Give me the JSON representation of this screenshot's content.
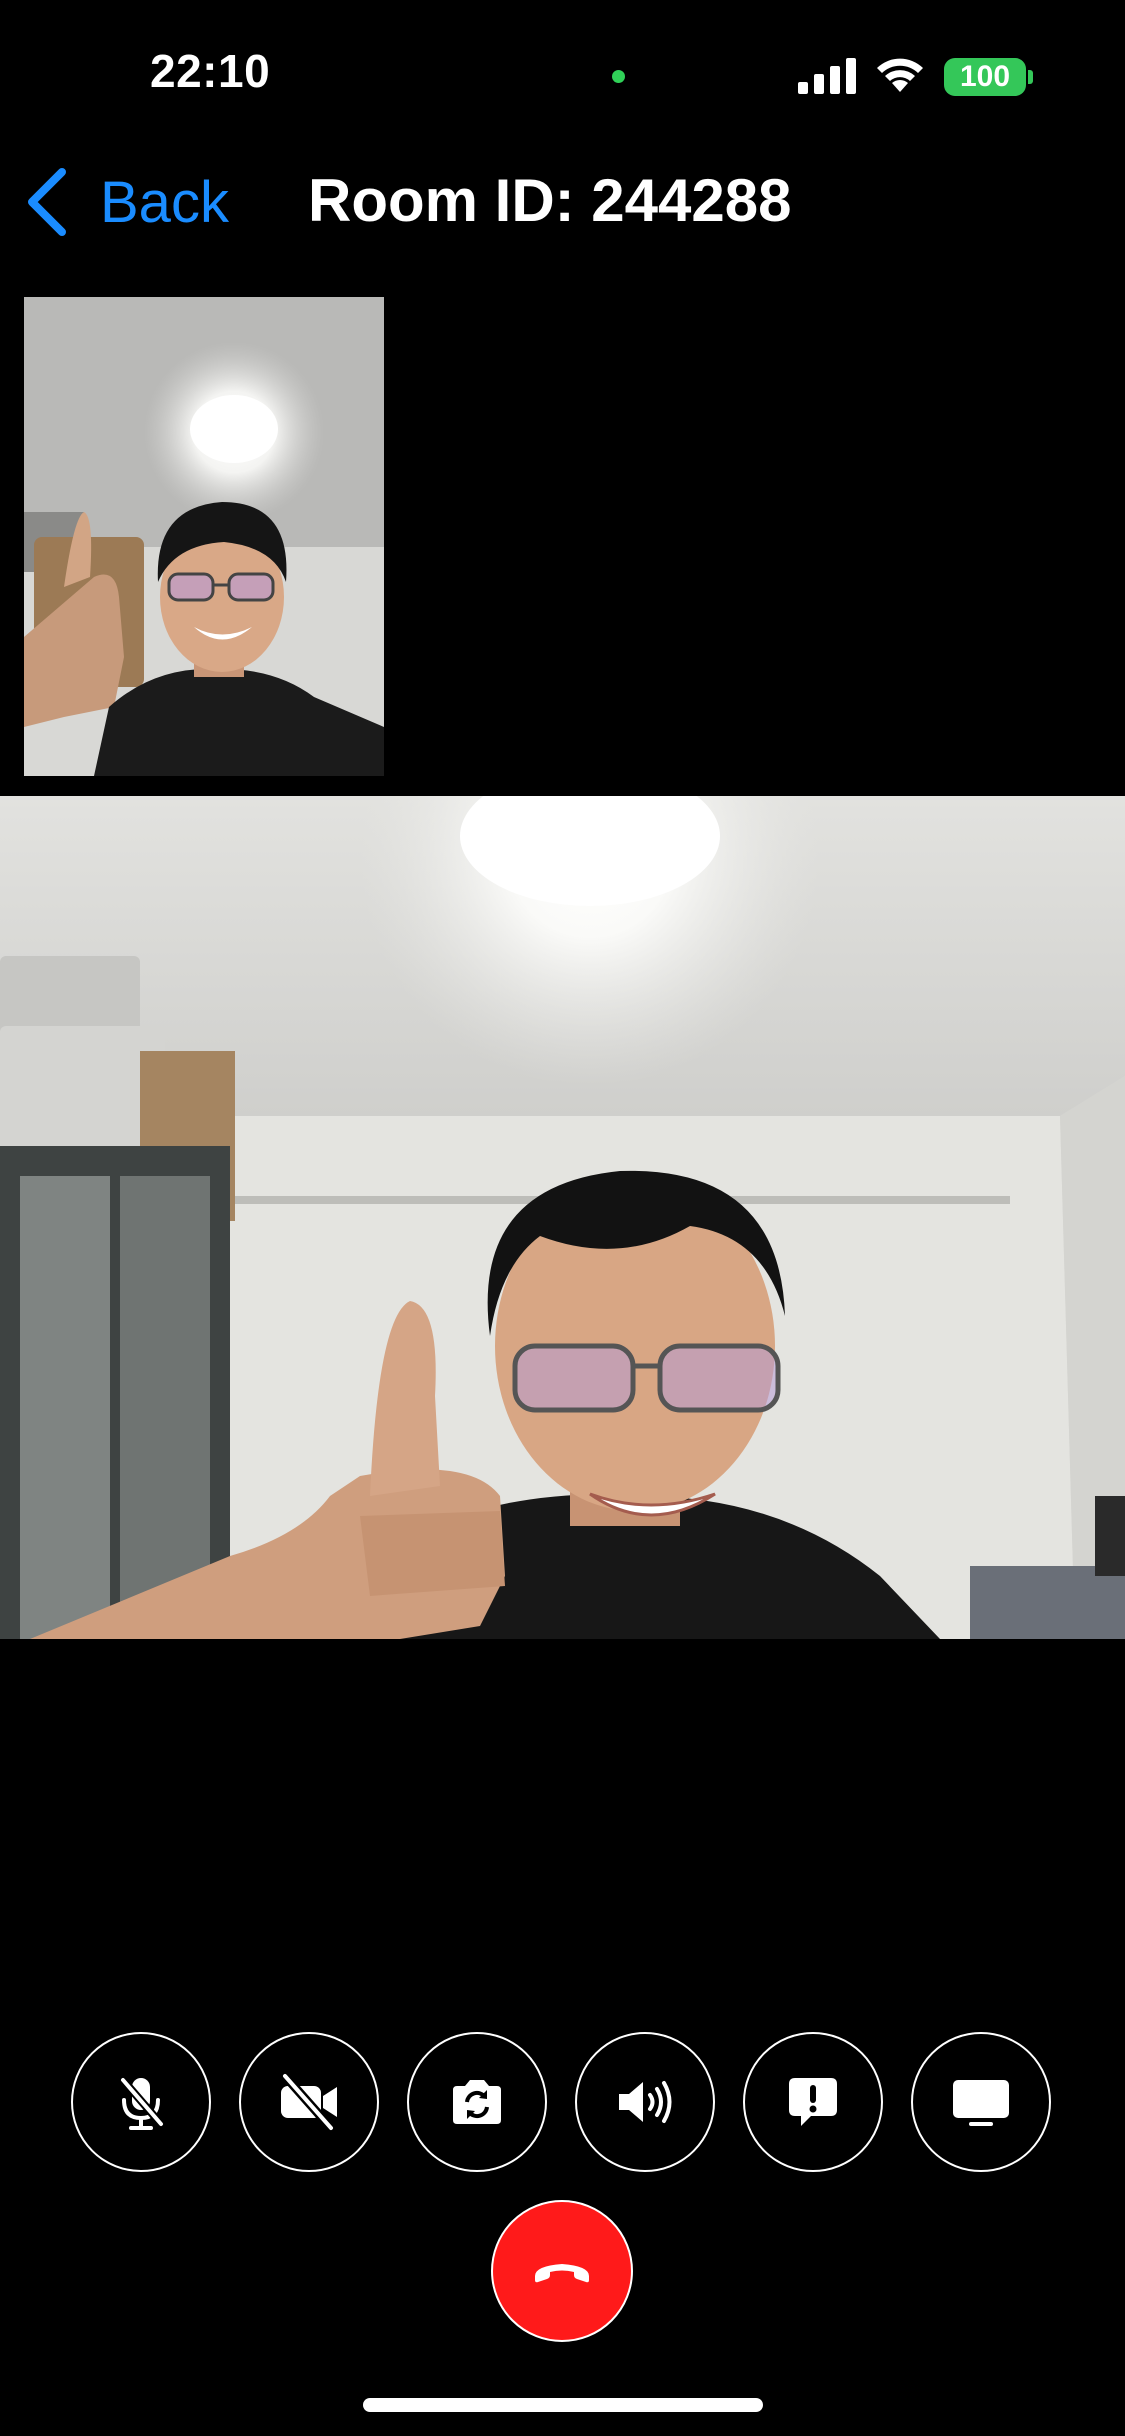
{
  "status_bar": {
    "time": "22:10",
    "battery": "100",
    "icons": [
      "privacy-dot",
      "signal-icon",
      "wifi-icon",
      "battery-icon"
    ]
  },
  "nav": {
    "back_label": "Back",
    "title": "Room ID: 244288",
    "back_icon": "chevron-left-icon"
  },
  "videos": {
    "local_preview": "camera-feed",
    "remote": "camera-feed"
  },
  "controls": [
    {
      "name": "mute-mic-button",
      "icon": "mic-off-icon"
    },
    {
      "name": "camera-off-button",
      "icon": "video-off-icon"
    },
    {
      "name": "switch-camera-button",
      "icon": "camera-switch-icon"
    },
    {
      "name": "speaker-button",
      "icon": "speaker-icon"
    },
    {
      "name": "report-button",
      "icon": "exclamation-bubble-icon"
    },
    {
      "name": "screen-share-button",
      "icon": "display-icon"
    }
  ],
  "end_call": {
    "icon": "phone-hangup-icon"
  },
  "colors": {
    "background": "#000000",
    "accent": "#1a8cff",
    "battery": "#34c759",
    "privacy_dot": "#30d158",
    "end_call": "#ff1a1a",
    "control_border": "#ffffff"
  }
}
